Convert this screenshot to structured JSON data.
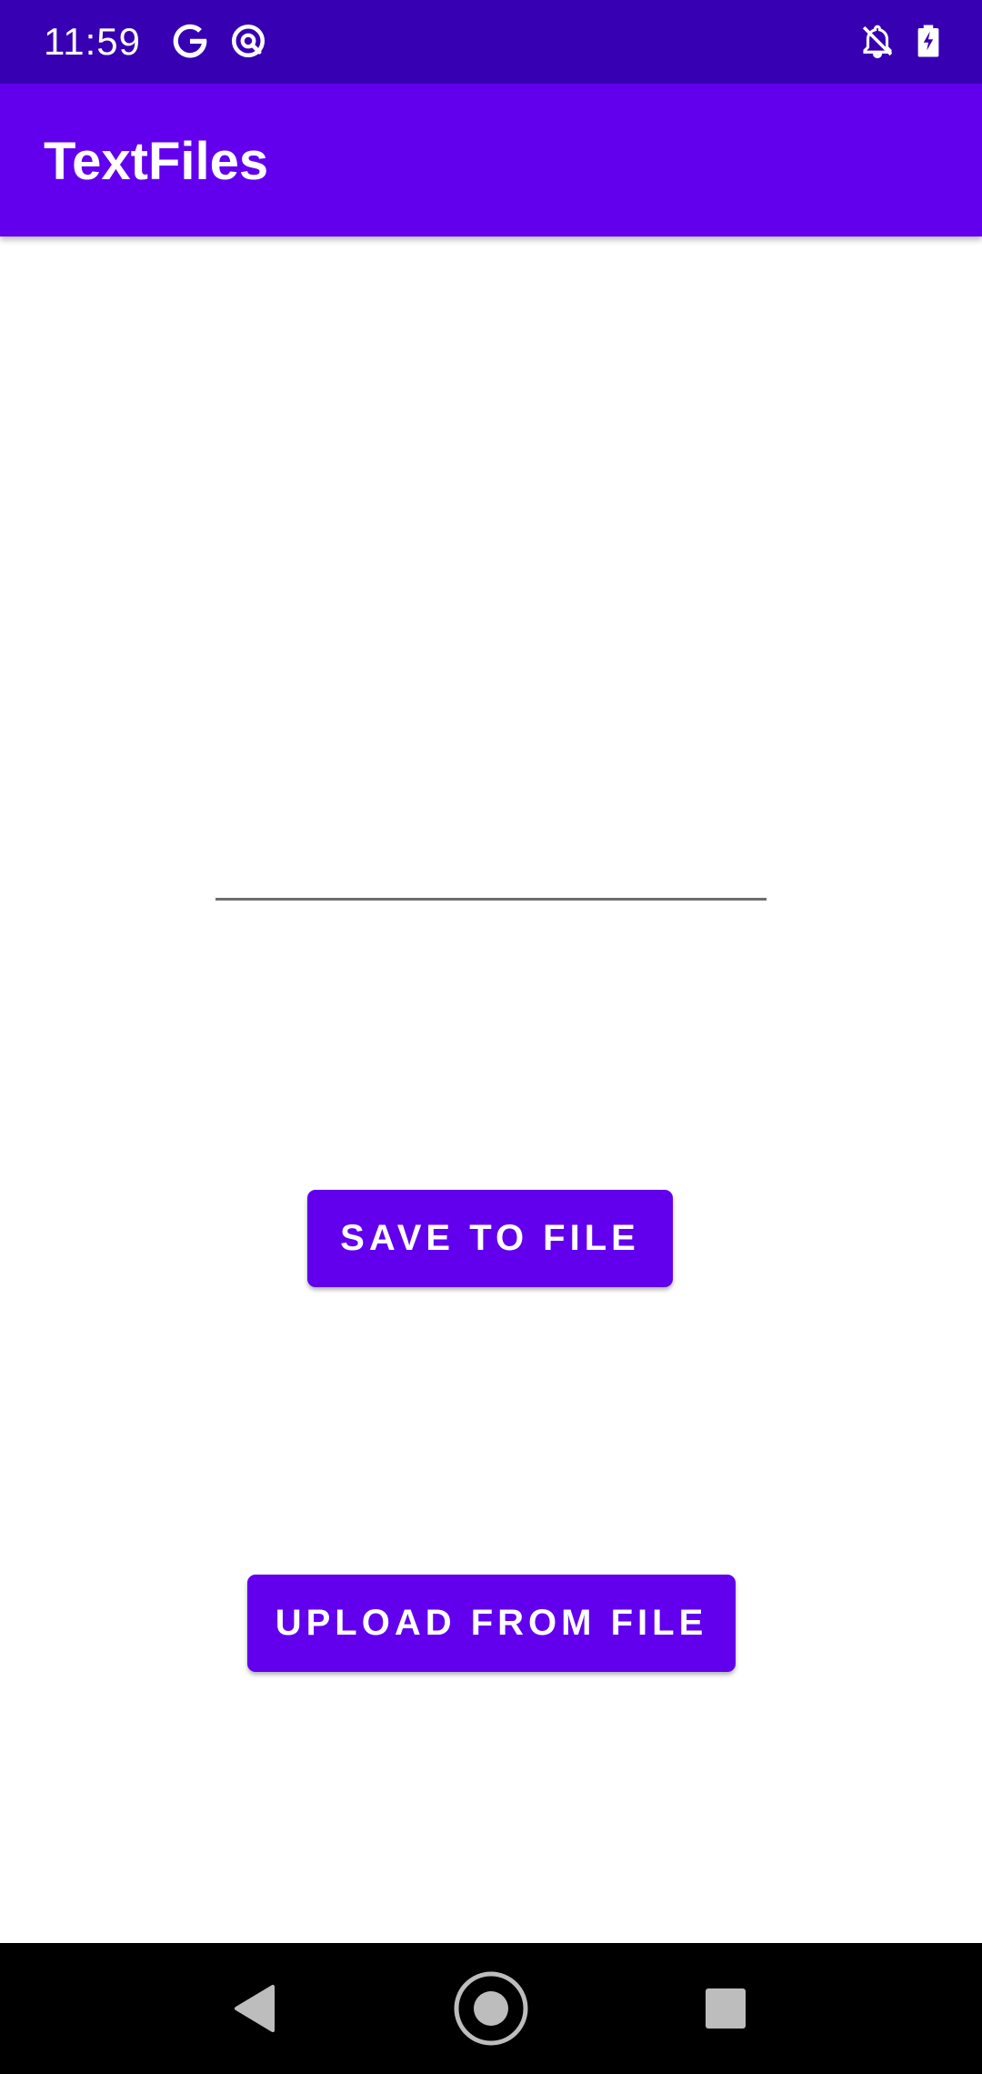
{
  "status_bar": {
    "time": "11:59",
    "icons": [
      "google-icon",
      "data-saver-icon",
      "notifications-off-icon",
      "battery-charging-icon"
    ]
  },
  "app_bar": {
    "title": "TextFiles"
  },
  "text_input": {
    "value": "",
    "placeholder": ""
  },
  "buttons": {
    "save_label": "SAVE TO FILE",
    "upload_label": "UPLOAD FROM FILE"
  },
  "nav_bar": {
    "icons": [
      "back-icon",
      "home-icon",
      "recents-icon"
    ]
  },
  "colors": {
    "status_bar": "#3700B3",
    "primary": "#6200EE",
    "background": "#FFFFFF",
    "nav_bar": "#000000"
  }
}
